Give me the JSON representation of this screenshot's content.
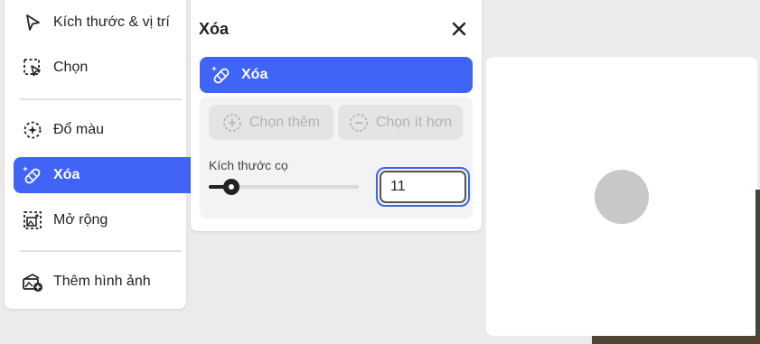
{
  "sidebar": {
    "items": [
      {
        "label": "Kích thước & vị trí",
        "icon": "pointer-icon"
      },
      {
        "label": "Chọn",
        "icon": "selection-icon"
      },
      {
        "label": "Đổ màu",
        "icon": "generative-fill-icon"
      },
      {
        "label": "Xóa",
        "icon": "eraser-bandage-icon",
        "active": true
      },
      {
        "label": "Mở rộng",
        "icon": "expand-icon"
      },
      {
        "label": "Thêm hình ảnh",
        "icon": "add-image-icon"
      }
    ]
  },
  "panel": {
    "title": "Xóa",
    "primary_label": "Xóa",
    "add_label": "Chọn thêm",
    "subtract_label": "Chọn ít hơn",
    "brush_size_label": "Kích thước cọ",
    "brush_size_value": "11"
  },
  "colors": {
    "accent": "#3f64f6",
    "background": "#ebebeb",
    "disabled_text": "#b2b2b2",
    "brush_preview": "#c8c8c8"
  }
}
